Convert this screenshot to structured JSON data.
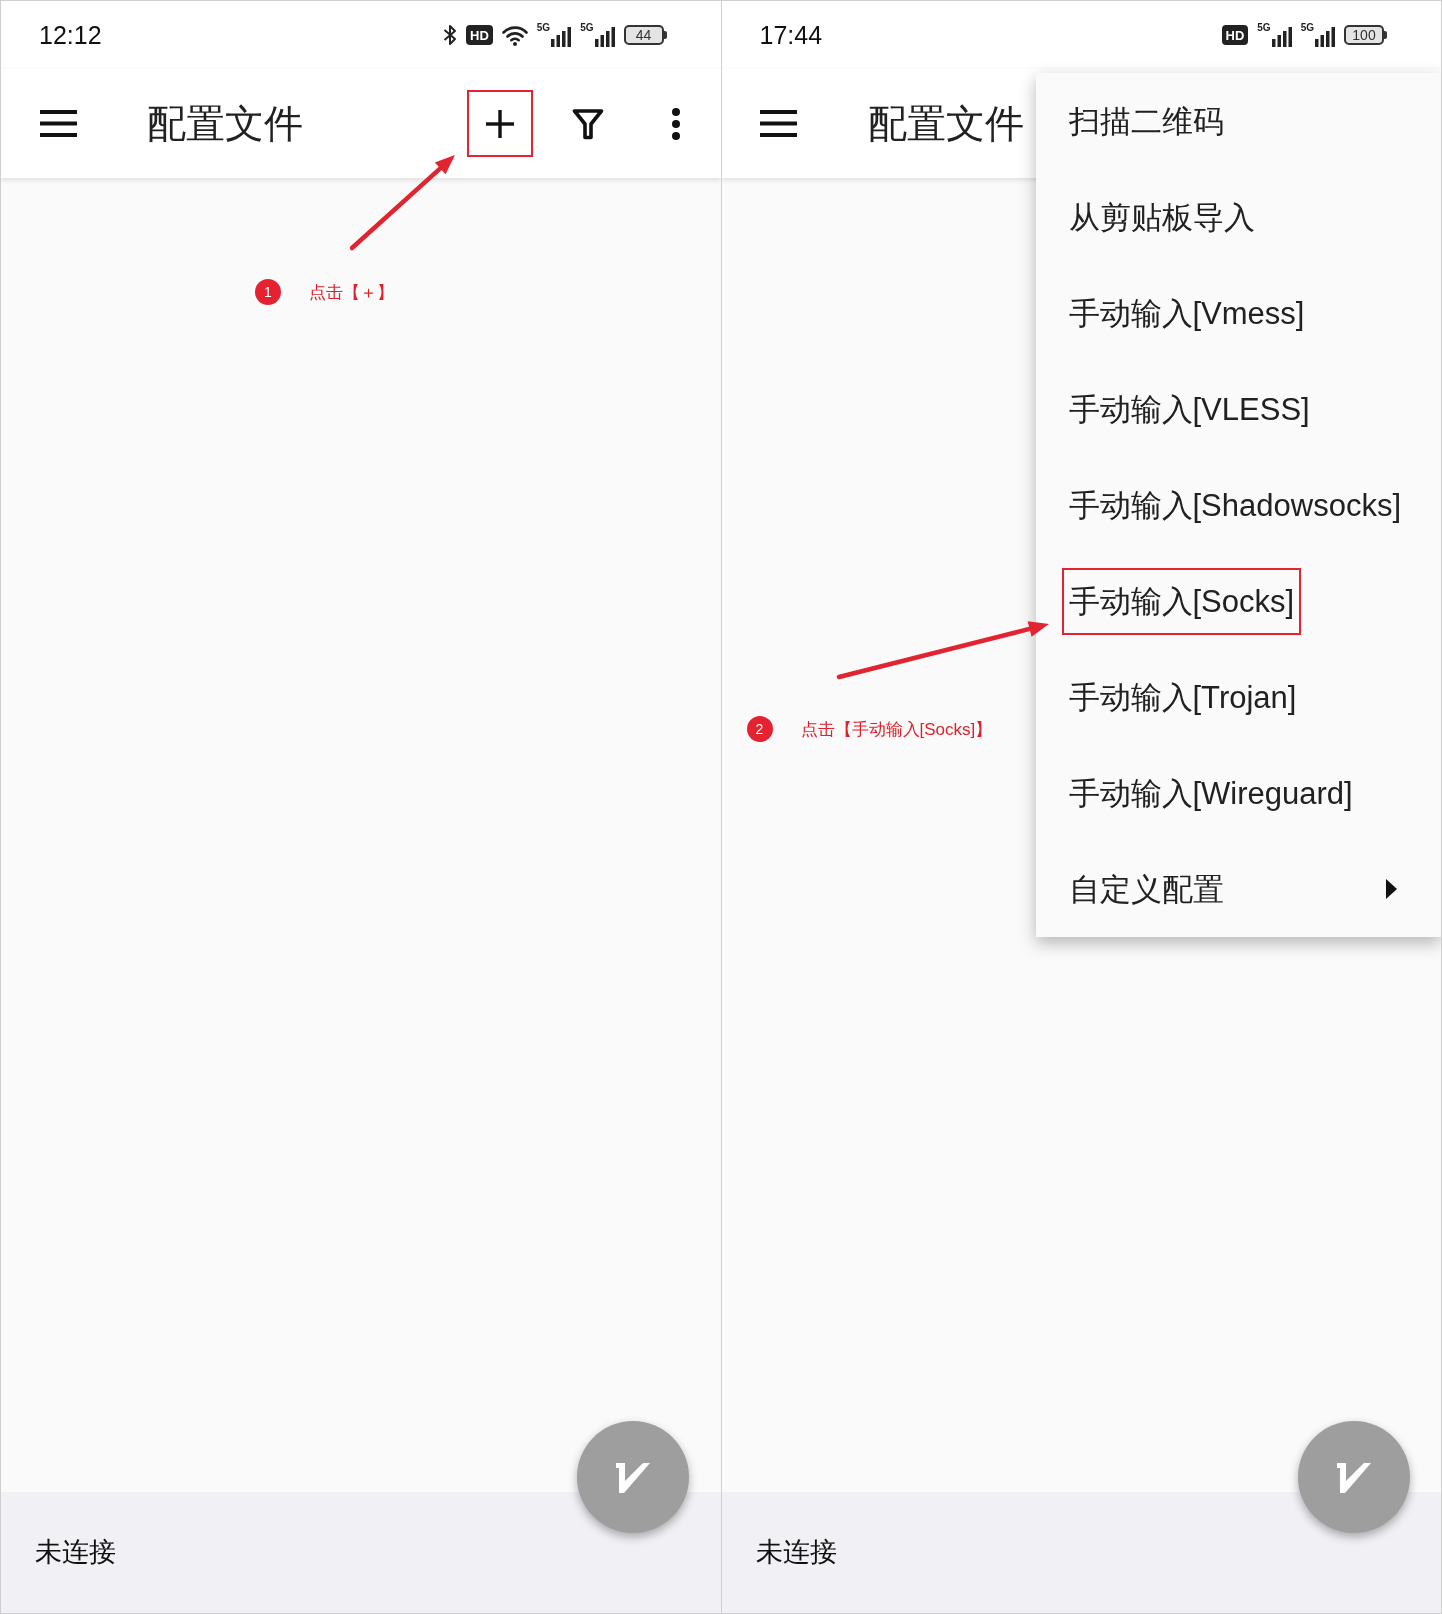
{
  "screens": [
    {
      "status_bar": {
        "time": "12:12",
        "icons": [
          {
            "kind": "bluetooth"
          },
          {
            "kind": "hd",
            "label": "HD"
          },
          {
            "kind": "wifi"
          },
          {
            "kind": "signal",
            "label": "5G"
          },
          {
            "kind": "signal",
            "label": "5G"
          },
          {
            "kind": "battery",
            "label": "44"
          }
        ]
      },
      "toolbar": {
        "title": "配置文件",
        "actions": [
          {
            "kind": "add",
            "highlighted": true
          },
          {
            "kind": "filter",
            "highlighted": false
          },
          {
            "kind": "more",
            "highlighted": false
          }
        ]
      },
      "annotation": {
        "step": "1",
        "text": "点击【＋】"
      },
      "status": "未连接"
    },
    {
      "status_bar": {
        "time": "17:44",
        "icons": [
          {
            "kind": "hd",
            "label": "HD"
          },
          {
            "kind": "signal",
            "label": "5G"
          },
          {
            "kind": "signal",
            "label": "5G"
          },
          {
            "kind": "battery",
            "label": "100"
          }
        ]
      },
      "toolbar": {
        "title": "配置文件"
      },
      "menu": {
        "items": [
          {
            "kind": "action",
            "label": "扫描二维码",
            "highlighted": false
          },
          {
            "kind": "action",
            "label": "从剪贴板导入",
            "highlighted": false
          },
          {
            "kind": "action",
            "label": "手动输入[Vmess]",
            "highlighted": false
          },
          {
            "kind": "action",
            "label": "手动输入[VLESS]",
            "highlighted": false
          },
          {
            "kind": "action",
            "label": "手动输入[Shadowsocks]",
            "highlighted": false
          },
          {
            "kind": "action",
            "label": "手动输入[Socks]",
            "highlighted": true
          },
          {
            "kind": "action",
            "label": "手动输入[Trojan]",
            "highlighted": false
          },
          {
            "kind": "action",
            "label": "手动输入[Wireguard]",
            "highlighted": false
          },
          {
            "kind": "submenu",
            "label": "自定义配置",
            "highlighted": false
          }
        ]
      },
      "annotation": {
        "step": "2",
        "text": "点击【手动输入[Socks]】"
      },
      "status": "未连接"
    }
  ]
}
